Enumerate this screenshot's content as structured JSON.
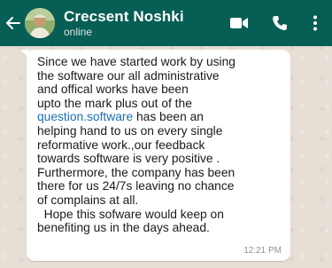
{
  "header": {
    "contact_name": "Crecsent Noshki",
    "status": "online",
    "colors": {
      "bar": "#075e54",
      "text": "#ffffff"
    },
    "icons": [
      "back-arrow-icon",
      "video-call-icon",
      "phone-call-icon",
      "more-options-icon"
    ]
  },
  "message": {
    "line_1": "Since we have started work by  using",
    "line_2": "the software our all administrative",
    "line_3": "and offical  works have been",
    "line_4": "upto the mark  plus out of the",
    "line_5_link": "question.software",
    "line_5_rest": " has been an",
    "line_6": "helping hand to us on every single",
    "line_7": "reformative work.,our feedback",
    "line_8": "towards software is very positive .",
    "line_9": "Furthermore, the company has been",
    "line_10": "there for us 24/7s leaving no chance",
    "line_11": "of complains at all.",
    "line_12": "  Hope this sofware would keep on",
    "line_13": "benefiting us in the days ahead.",
    "time": "12:21 PM",
    "link_color": "#1b6fb4"
  }
}
